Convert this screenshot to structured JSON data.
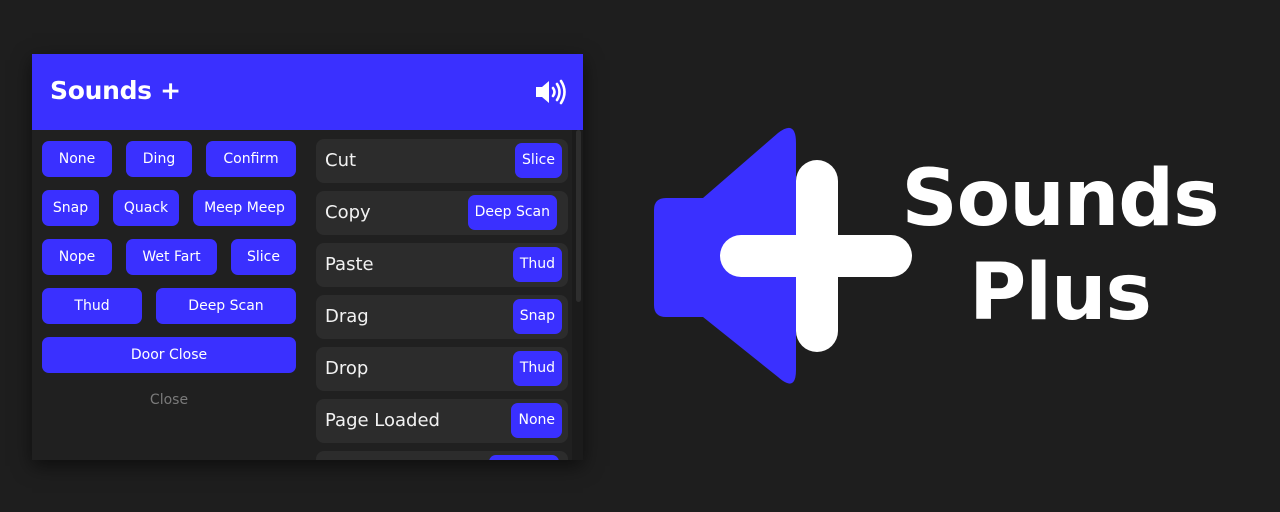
{
  "panel": {
    "title": "Sounds +",
    "header_icon": "volume-icon",
    "sound_rows": [
      [
        "None",
        "Ding",
        "Confirm"
      ],
      [
        "Snap",
        "Quack",
        "Meep Meep"
      ],
      [
        "Nope",
        "Wet Fart",
        "Slice"
      ],
      [
        "Thud",
        "Deep Scan"
      ],
      [
        "Door Close"
      ]
    ],
    "close_label": "Close",
    "events": [
      {
        "label": "Cut",
        "sound": "Slice"
      },
      {
        "label": "Copy",
        "sound": "Deep Scan"
      },
      {
        "label": "Paste",
        "sound": "Thud"
      },
      {
        "label": "Drag",
        "sound": "Snap"
      },
      {
        "label": "Drop",
        "sound": "Thud"
      },
      {
        "label": "Page Loaded",
        "sound": "None"
      },
      {
        "label": "",
        "sound": ""
      }
    ]
  },
  "branding": {
    "logo_icon": "speaker-plus-icon",
    "line1": "Sounds",
    "line2": "Plus"
  },
  "colors": {
    "accent": "#3a30ff",
    "background": "#1e1e1e",
    "panel": "#202020",
    "row": "#2c2c2c"
  }
}
